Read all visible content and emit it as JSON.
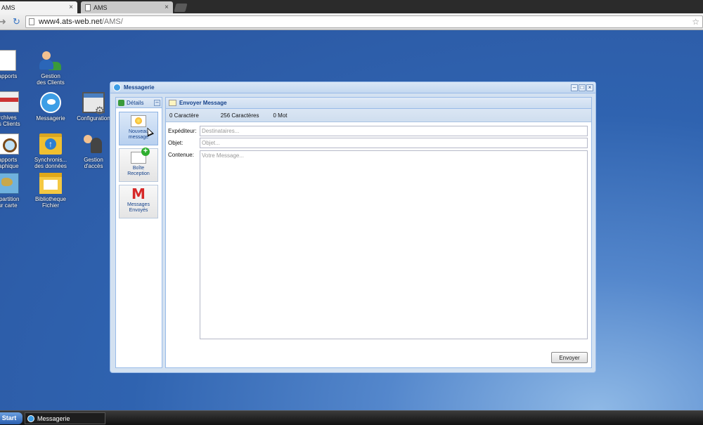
{
  "browser": {
    "tabs": [
      {
        "label": "AMS"
      },
      {
        "label": "AMS"
      }
    ],
    "tab_close": "×",
    "url_host": "www4.ats-web.net",
    "url_path": "/AMS/"
  },
  "desktop": {
    "icons": [
      {
        "line1": "apports",
        "line2": ""
      },
      {
        "line1": "Gestion",
        "line2": "des Clients"
      },
      {
        "line1": "rchives",
        "line2": "es Clients"
      },
      {
        "line1": "Messagerie",
        "line2": ""
      },
      {
        "line1": "Configuration",
        "line2": ""
      },
      {
        "line1": "apports",
        "line2": "raphique"
      },
      {
        "line1": "Synchronis...",
        "line2": "des données"
      },
      {
        "line1": "Gestion",
        "line2": "d'accès"
      },
      {
        "line1": "épartition",
        "line2": "ur carte"
      },
      {
        "line1": "Bibliotheque",
        "line2": "Fichier"
      }
    ]
  },
  "window": {
    "title": "Messagerie",
    "west": {
      "title": "Détails",
      "items": [
        {
          "line1": "Nouveau",
          "line2": "message"
        },
        {
          "line1": "Boîte",
          "line2": "Reception"
        },
        {
          "line1": "Messages",
          "line2": "Envoyés"
        }
      ]
    },
    "center": {
      "title": "Envoyer Message",
      "char_count": "0 Caractère",
      "remaining": "256 Caractères",
      "word_count": "0 Mot",
      "fields": {
        "sender_label": "Expéditeur:",
        "sender_placeholder": "Destinataires...",
        "subject_label": "Objet:",
        "subject_placeholder": "Objet...",
        "content_label": "Contenue:",
        "content_placeholder": "Votre Message..."
      },
      "send_button": "Envoyer"
    }
  },
  "taskbar": {
    "start": "Start",
    "task_label": "Messagerie"
  }
}
